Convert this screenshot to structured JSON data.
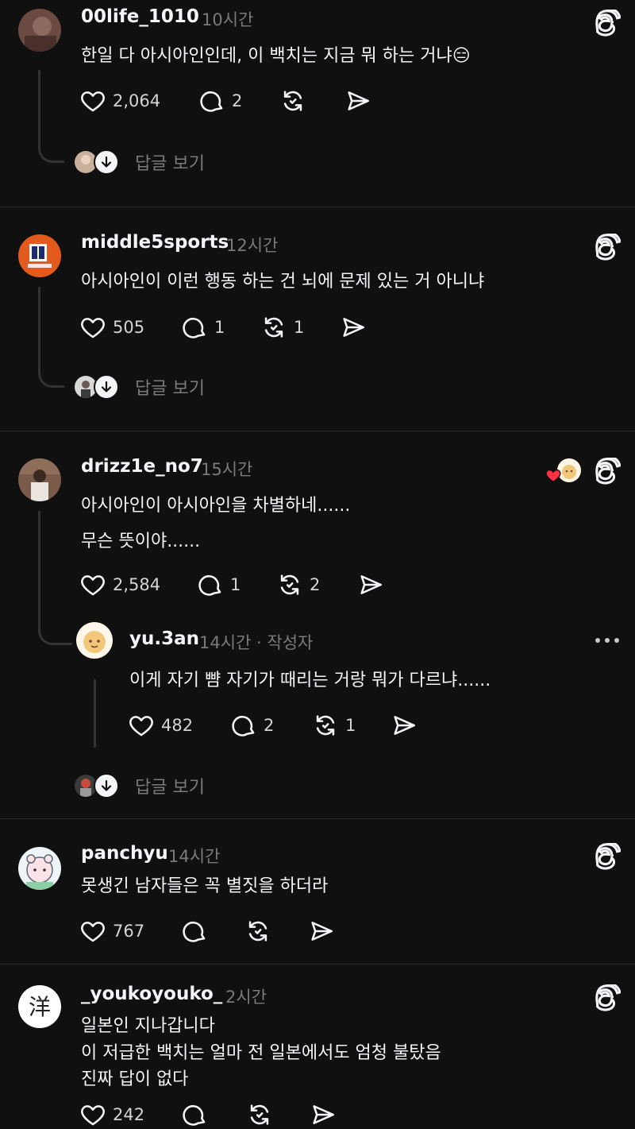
{
  "posts": [
    {
      "username": "00life_1010",
      "time": "10시간",
      "lines": [
        "한일 다 아시아인인데, 이 백치는 지금 뭐 하는 거냐😑"
      ],
      "likes": "2,064",
      "comments": "2",
      "reposts": "",
      "replies_label": "답글 보기"
    },
    {
      "username": "middle5sports",
      "time": "12시간",
      "lines": [
        "아시아인이 이런 행동 하는 건 뇌에 문제 있는 거 아니냐"
      ],
      "likes": "505",
      "comments": "1",
      "reposts": "1",
      "replies_label": "답글 보기"
    },
    {
      "username": "drizz1e_no7",
      "time": "15시간",
      "lines": [
        "아시아인이 아시아인을 차별하네......",
        "무슨 뜻이야......"
      ],
      "likes": "2,584",
      "comments": "1",
      "reposts": "2",
      "reply": {
        "username": "yu.3an",
        "time": "14시간 · 작성자",
        "text": "이게 자기 뺨 자기가 때리는 거랑 뭐가 다르냐......",
        "likes": "482",
        "comments": "2",
        "reposts": "1"
      },
      "replies_label": "답글 보기"
    },
    {
      "username": "panchyu",
      "time": "14시간",
      "lines": [
        "못생긴 남자들은 꼭 별짓을 하더라"
      ],
      "likes": "767",
      "comments": "",
      "reposts": ""
    },
    {
      "username": "_youkoyouko_",
      "time": "2시간",
      "lines": [
        "일본인 지나갑니다",
        "이 저급한 백치는 얼마 전 일본에서도 엄청 불탔음",
        "진짜 답이 없다"
      ],
      "likes": "242",
      "comments": "",
      "reposts": ""
    }
  ],
  "icons": {
    "like": "heart-icon",
    "comment": "comment-bubble-icon",
    "repost": "repost-icon",
    "share": "send-icon",
    "brand": "threads-icon"
  },
  "colors": {
    "background": "#101010",
    "text": "#f3f5f7",
    "muted": "#7a7a7a",
    "heart": "#ff3040"
  }
}
